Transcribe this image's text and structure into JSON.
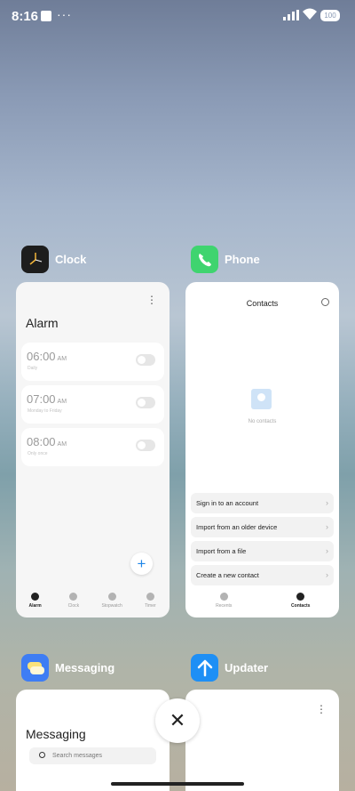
{
  "status_bar": {
    "time": "8:16",
    "more": "···",
    "battery": "100"
  },
  "apps": {
    "clock": {
      "name": "Clock",
      "screen_title": "Alarm",
      "alarms": [
        {
          "time": "06:00",
          "ampm": "AM",
          "sub": "Daily"
        },
        {
          "time": "07:00",
          "ampm": "AM",
          "sub": "Monday to Friday"
        },
        {
          "time": "08:00",
          "ampm": "AM",
          "sub": "Only once"
        }
      ],
      "fab": "+",
      "nav": [
        "Alarm",
        "Clock",
        "Stopwatch",
        "Timer"
      ]
    },
    "phone": {
      "name": "Phone",
      "screen_title": "Contacts",
      "empty_text": "No contacts",
      "options": [
        "Sign in to an account",
        "Import from an older device",
        "Import from a file",
        "Create a new contact"
      ],
      "chevron": "›",
      "nav": [
        "Recents",
        "Contacts"
      ]
    },
    "messaging": {
      "name": "Messaging",
      "screen_title": "Messaging",
      "search_placeholder": "Search messages"
    },
    "updater": {
      "name": "Updater"
    }
  },
  "close_button": "✕",
  "colors": {
    "phone_icon": "#3fd46f",
    "messaging_icon": "#3e7df4",
    "updater_icon": "#1e8ff5",
    "fab_accent": "#1f86e8"
  }
}
